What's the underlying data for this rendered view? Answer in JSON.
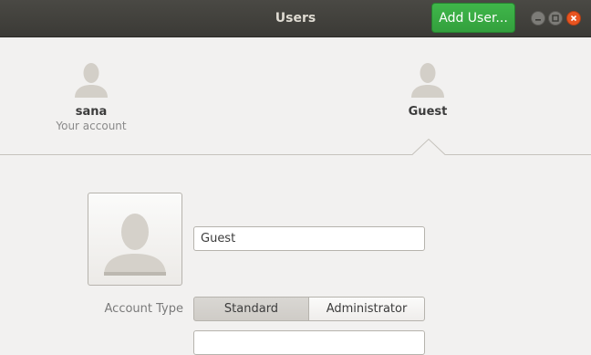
{
  "window": {
    "title": "Users",
    "add_user_label": "Add User...",
    "controls": [
      "minimize-icon",
      "maximize-icon",
      "close-icon"
    ]
  },
  "users": [
    {
      "name": "sana",
      "subtitle": "Your account",
      "icon": "person-silhouette-icon"
    },
    {
      "name": "Guest",
      "subtitle": "",
      "icon": "person-silhouette-icon",
      "selected": true
    }
  ],
  "details": {
    "avatar_icon": "person-silhouette-icon",
    "name_value": "Guest",
    "account_type_label": "Account Type",
    "account_types": [
      "Standard",
      "Administrator"
    ],
    "selected_account_type": "Standard"
  },
  "colors": {
    "accent_green": "#3fb64a",
    "close_orange": "#e95420",
    "titlebar": "#3b3a36",
    "background": "#f2f1f0"
  }
}
